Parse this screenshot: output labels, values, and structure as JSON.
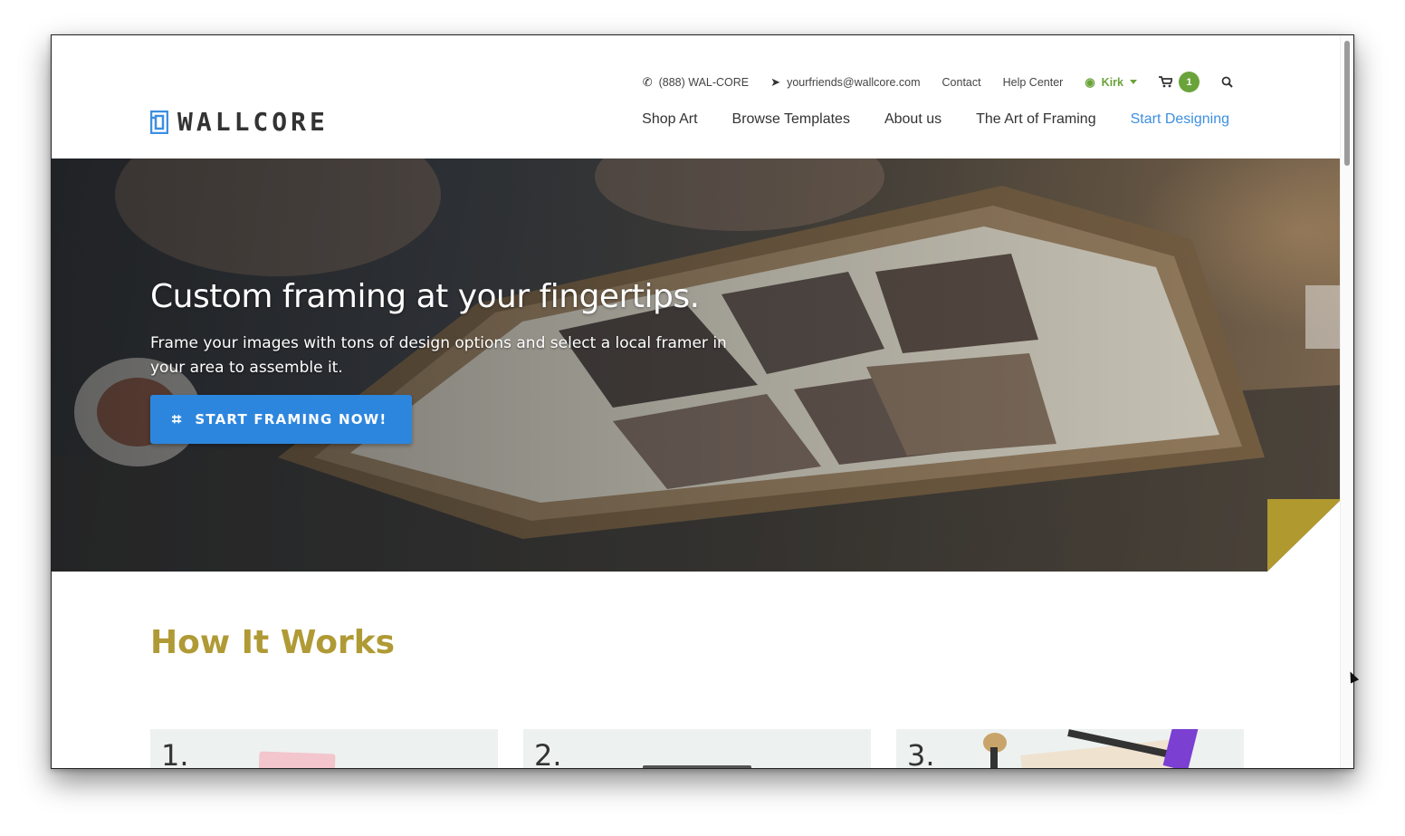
{
  "brand": {
    "name": "WALLCORE",
    "logo_icon": "wallcore-logo-icon"
  },
  "utility": {
    "phone": {
      "icon": "phone-icon",
      "label": "(888) WAL-CORE"
    },
    "email": {
      "icon": "paper-plane-icon",
      "label": "yourfriends@wallcore.com"
    },
    "contact_label": "Contact",
    "help_label": "Help Center",
    "user": {
      "icon": "user-circle-icon",
      "name": "Kirk"
    },
    "cart": {
      "icon": "cart-icon",
      "count": "1"
    },
    "search_icon": "search-icon"
  },
  "nav": {
    "items": [
      {
        "label": "Shop Art"
      },
      {
        "label": "Browse Templates"
      },
      {
        "label": "About us"
      },
      {
        "label": "The Art of Framing"
      },
      {
        "label": "Start Designing",
        "active": true
      }
    ]
  },
  "hero": {
    "title": "Custom framing at your fingertips.",
    "subtitle": "Frame your images with tons of design options and select a local framer in your area to assemble it.",
    "cta_label": "START FRAMING NOW!",
    "cta_icon": "crop-icon"
  },
  "how": {
    "title": "How It Works",
    "steps": [
      {
        "num": "1."
      },
      {
        "num": "2."
      },
      {
        "num": "3."
      }
    ]
  },
  "colors": {
    "accent_blue": "#3d8fe0",
    "cta_blue": "#2d86de",
    "user_green": "#6ba33b",
    "how_gold": "#b09a35",
    "fold_gold": "#b0992f"
  }
}
